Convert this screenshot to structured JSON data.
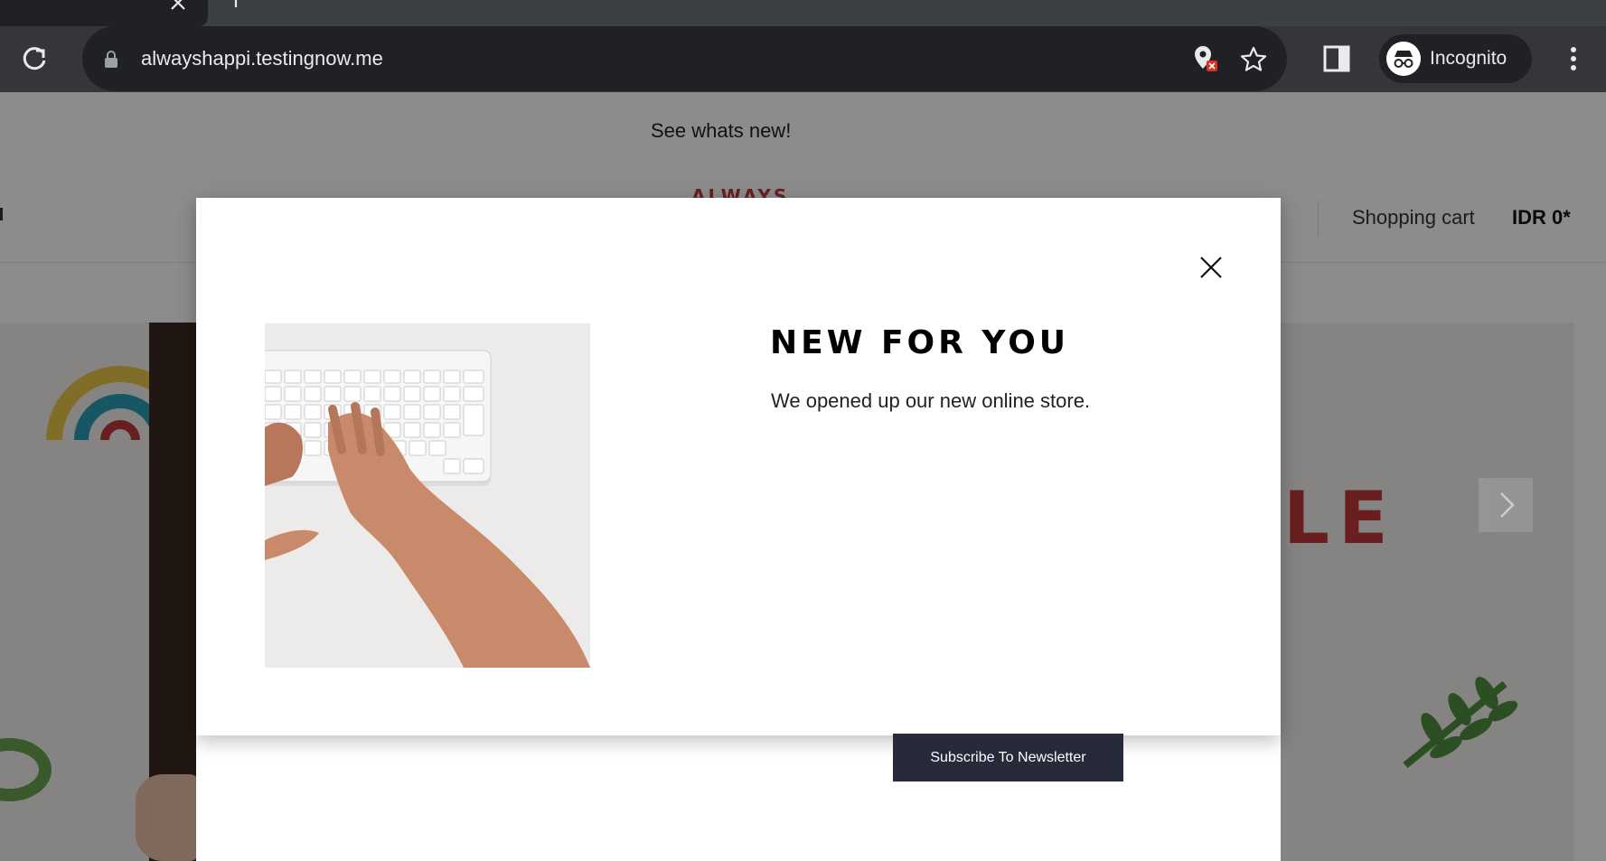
{
  "browser": {
    "url": "alwayshappi.testingnow.me",
    "profile_label": "Incognito"
  },
  "page": {
    "announcement": "See whats new!",
    "logo_text": "ALWAYS",
    "cart_label": "Shopping cart",
    "cart_total": "IDR 0*",
    "hero_text": "LE"
  },
  "modal": {
    "title": "NEW FOR YOU",
    "text": "We opened up our new online store.",
    "subscribe_label": "Subscribe To Newsletter"
  },
  "colors": {
    "chrome_dark": "#202124",
    "chrome_toolbar": "#35363a",
    "button_dark": "#262a3a",
    "sale_red": "#c03a3a"
  }
}
